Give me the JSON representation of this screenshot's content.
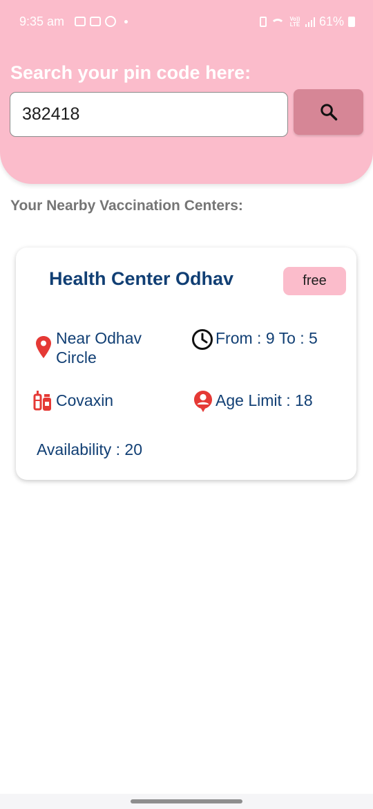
{
  "status_bar": {
    "time": "9:35 am",
    "battery": "61%",
    "network": "Vo)) LTE"
  },
  "search": {
    "title": "Search your pin code here:",
    "value": "382418"
  },
  "section_title": "Your Nearby Vaccination Centers:",
  "center": {
    "name": "Health Center Odhav",
    "fee_type": "free",
    "address_line1": "Near Odhav",
    "address_line2": "Circle",
    "timing": "From : 9 To : 5",
    "vaccine": "Covaxin",
    "age_limit": "Age Limit : 18",
    "availability": "Availability : 20"
  },
  "colors": {
    "header_bg": "#fbbccb",
    "search_button": "#d68696",
    "text_primary": "#113f74",
    "icon_red": "#e53935"
  },
  "icons": [
    "search-icon",
    "location-pin-icon",
    "clock-icon",
    "vaccine-icon",
    "person-icon"
  ]
}
